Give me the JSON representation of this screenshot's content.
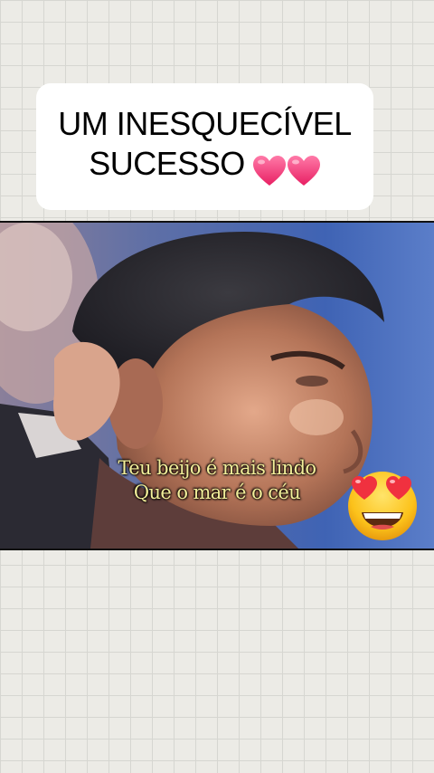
{
  "title_card": {
    "line1": "UM INESQUECÍVEL",
    "line2": "SUCESSO",
    "emoji": "two-pink-hearts"
  },
  "video": {
    "subtitle_line1": "Teu beijo é mais lindo",
    "subtitle_line2": "Que o mar é o céu",
    "sticker": "heart-eyes-emoji"
  },
  "colors": {
    "background": "#ecebe6",
    "card": "#ffffff",
    "subtitle": "#f3ef9a",
    "heart": "#f0457f"
  }
}
